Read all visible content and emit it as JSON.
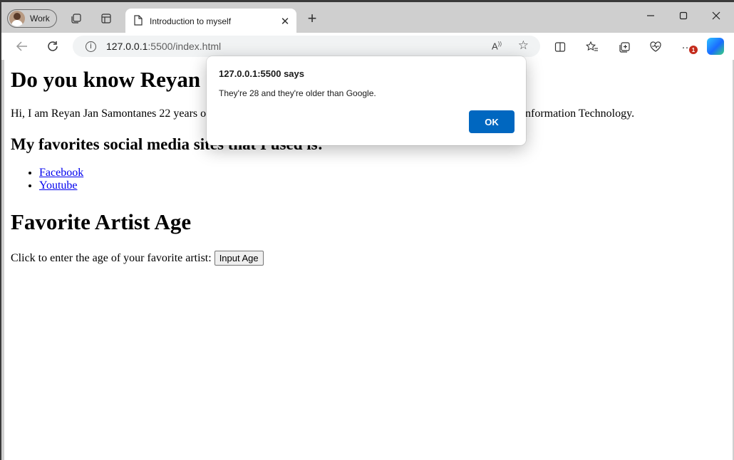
{
  "browser": {
    "profile_label": "Work",
    "tab_title": "Introduction to myself",
    "new_tab_symbol": "+",
    "tab_close_symbol": "✕",
    "address": {
      "host": "127.0.0.1",
      "path": ":5500/index.html"
    },
    "read_aloud_label": "Aͅ",
    "notification_count": "1"
  },
  "page": {
    "heading": "Do you know Reyan",
    "intro": "Hi, I am Reyan Jan Samontanes 22 years o",
    "intro_tail": "nformation Technology.",
    "social_heading": "My favorites social media s",
    "social_heading_tail": "ites that I used is:",
    "links": [
      "Facebook",
      "Youtube"
    ],
    "artist_heading": "Favorite Artist Age",
    "prompt_text": "Click to enter the age of your favorite artist:",
    "input_button": "Input Age"
  },
  "dialog": {
    "title": "127.0.0.1:5500 says",
    "message": "They're 28 and they're older than Google.",
    "ok_label": "OK"
  },
  "colors": {
    "accent": "#0067c0",
    "link": "#0000ee",
    "chrome": "#cfcfcf",
    "badge": "#c42b1c"
  },
  "icons": [
    "workspaces-icon",
    "tab-actions-icon",
    "document-icon",
    "back-icon",
    "refresh-icon",
    "info-icon",
    "read-aloud-icon",
    "favorite-star-icon",
    "split-screen-icon",
    "favorites-icon",
    "collections-icon",
    "browser-essentials-icon",
    "more-icon",
    "copilot-icon",
    "minimize-icon",
    "maximize-icon",
    "close-window-icon"
  ]
}
